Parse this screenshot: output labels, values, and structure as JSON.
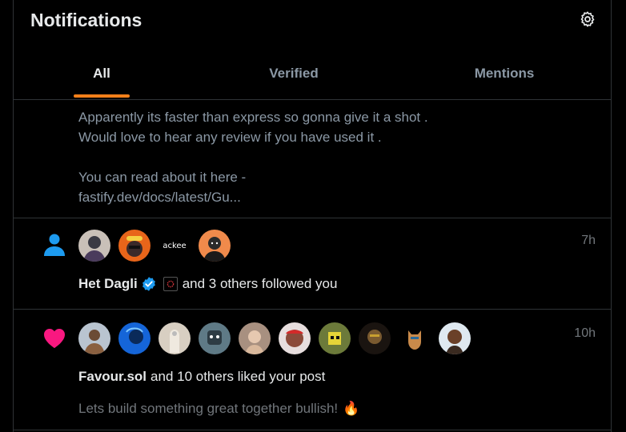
{
  "header": {
    "title": "Notifications",
    "settings_icon": "gear-icon"
  },
  "tabs": [
    {
      "label": "All",
      "active": true
    },
    {
      "label": "Verified",
      "active": false
    },
    {
      "label": "Mentions",
      "active": false
    }
  ],
  "accent_color": "#f4801a",
  "post_tail": {
    "lines": [
      "Apparently its faster than express so gonna give it a shot .",
      "Would love to hear any review if you have used it .",
      "",
      "You can read about it here -",
      "fastify.dev/docs/latest/Gu..."
    ]
  },
  "notifications": [
    {
      "type": "follow",
      "icon": "person-icon",
      "icon_color": "#1d9bf0",
      "time": "7h",
      "avatar_text_label": "ackee",
      "actor": "Het Dagli",
      "verified_icon": "verified-badge-icon",
      "rest": "and 3 others followed you"
    },
    {
      "type": "like",
      "icon": "heart-icon",
      "icon_color": "#f91880",
      "time": "10h",
      "actor": "Favour.sol",
      "rest": "and 10 others liked your post",
      "preview": "Lets build something great together bullish!",
      "preview_emoji": "🔥"
    }
  ]
}
